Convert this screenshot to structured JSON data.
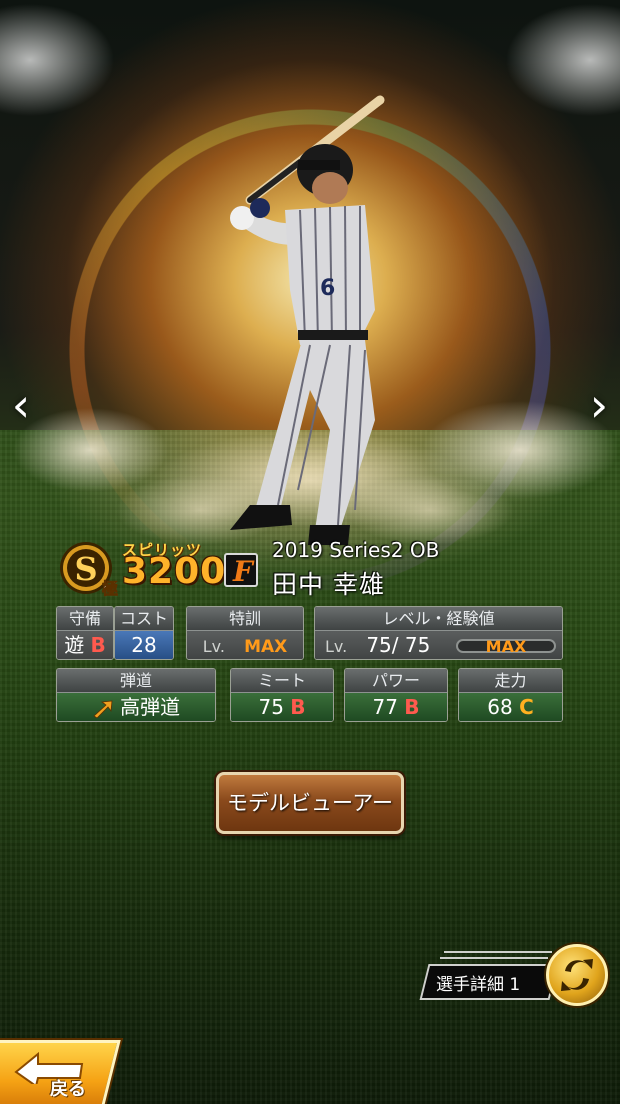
{
  "card": {
    "series": "2019 Series2 OB",
    "player_name": "田中 幸雄",
    "rank": "S",
    "rank_sub": "極",
    "spirits_label": "スピリッツ",
    "spirits_value": "3200",
    "team_logo_letter": "F"
  },
  "stats": {
    "defense": {
      "label": "守備",
      "position": "遊",
      "grade": "B"
    },
    "cost": {
      "label": "コスト",
      "value": "28"
    },
    "training": {
      "label": "特訓",
      "lv": "Lv.",
      "value": "MAX"
    },
    "level": {
      "label": "レベル・経験値",
      "lv": "Lv.",
      "current": "75",
      "separator": "/",
      "max": "75",
      "exp_bar_label": "MAX",
      "exp_progress": 1.0
    },
    "trajectory": {
      "label": "弾道",
      "value": "高弾道"
    },
    "meet": {
      "label": "ミート",
      "value": "75",
      "grade": "B"
    },
    "power": {
      "label": "パワー",
      "value": "77",
      "grade": "B"
    },
    "speed": {
      "label": "走力",
      "value": "68",
      "grade": "C"
    }
  },
  "buttons": {
    "model_viewer": "モデルビューアー",
    "player_detail": "選手詳細 1",
    "back": "戻る",
    "prev_arrow": "‹",
    "next_arrow": "›"
  },
  "colors": {
    "grade_b": "#ff5a4e",
    "grade_c": "#ffb020",
    "max": "#ff9a1a",
    "spirits": "#ffb32a"
  }
}
